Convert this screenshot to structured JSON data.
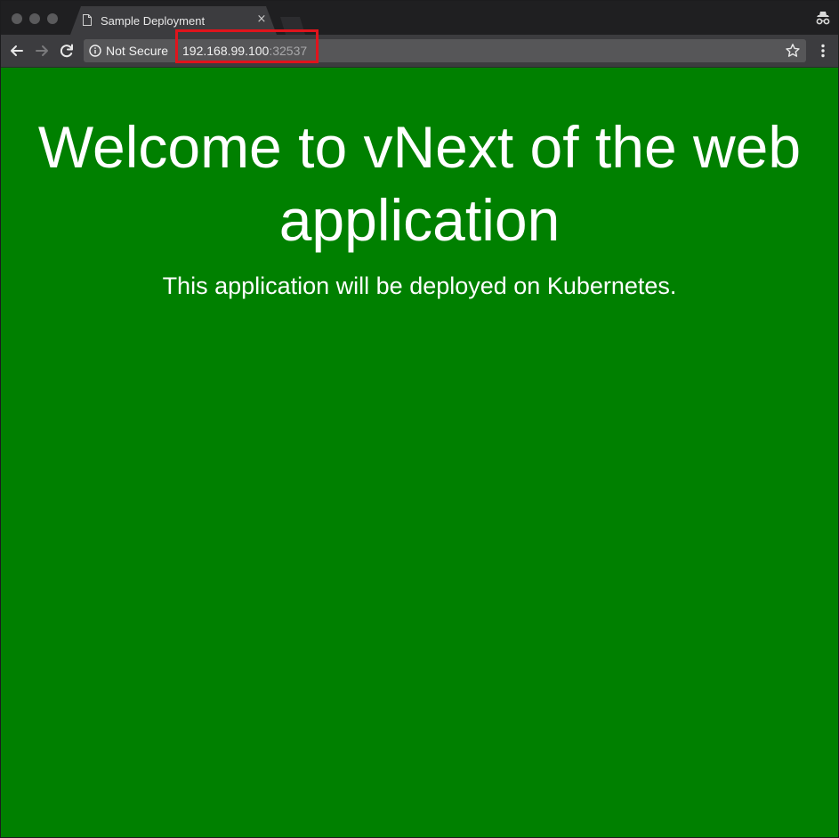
{
  "browser": {
    "tab": {
      "title": "Sample Deployment",
      "close_label": "×"
    },
    "toolbar": {
      "security_label": "Not Secure",
      "url_host": "192.168.99.100",
      "url_port": ":32537"
    },
    "icons": {
      "traffic_lights": [
        "close-dot",
        "minimize-dot",
        "zoom-dot"
      ],
      "tab_icon": "document-icon",
      "back": "arrow-left-icon",
      "forward": "arrow-right-icon",
      "reload": "reload-icon",
      "info": "info-icon",
      "bookmark": "star-icon",
      "menu": "more-vertical-icon",
      "incognito": "incognito-icon"
    },
    "colors": {
      "chrome_dark": "#1f1f21",
      "toolbar": "#3c3c3f",
      "omnibox": "#565658",
      "highlight": "#e0141c"
    }
  },
  "page": {
    "heading": "Welcome to vNext of the web application",
    "subheading": "This application will be deployed on Kubernetes.",
    "background_color": "#008000",
    "text_color": "#ffffff"
  }
}
